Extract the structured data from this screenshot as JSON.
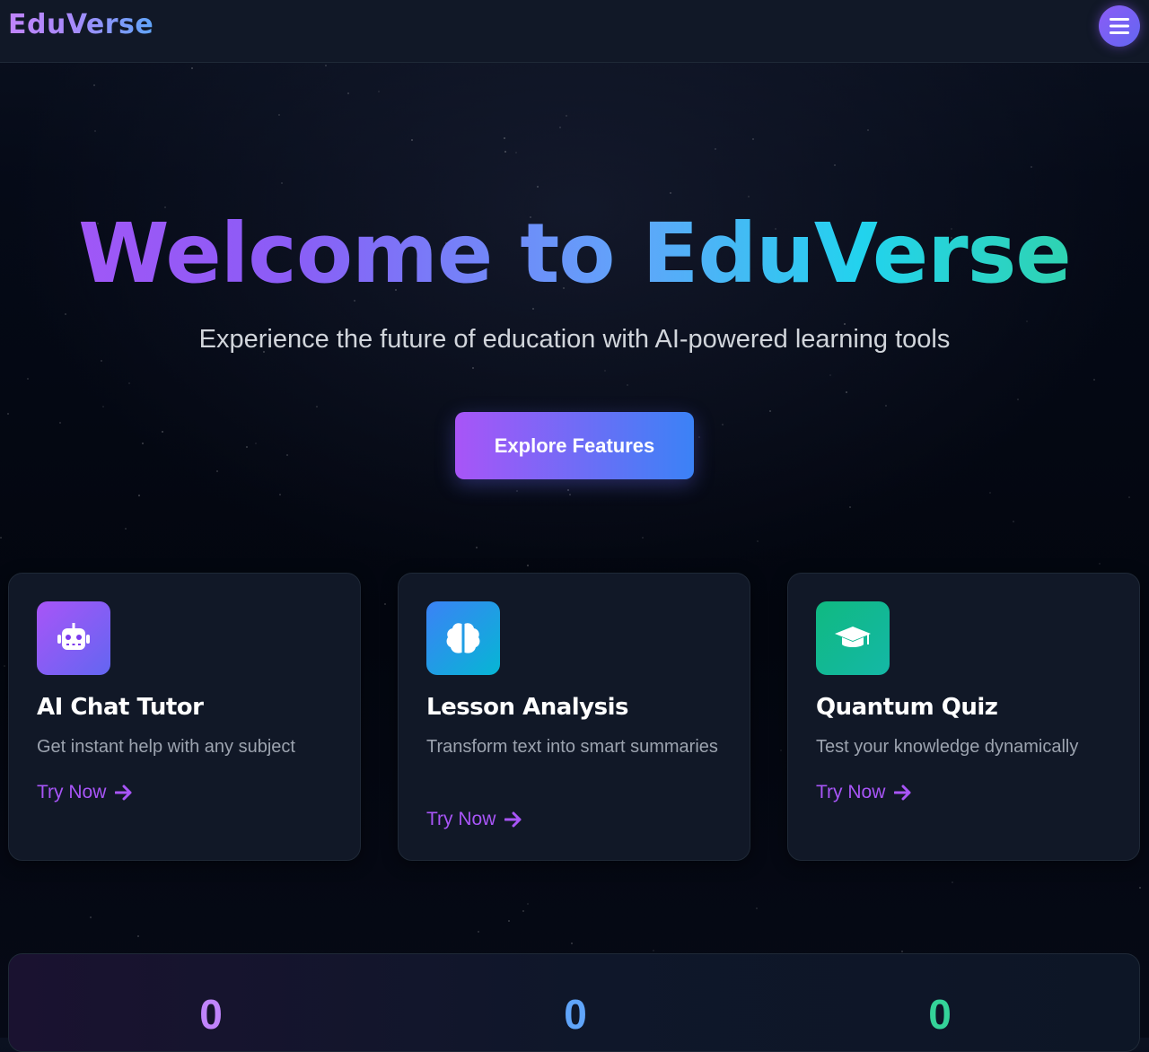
{
  "header": {
    "logo_text": "EduVerse",
    "menu_icon": "hamburger-menu-icon"
  },
  "hero": {
    "title": "Welcome to EduVerse",
    "subtitle": "Experience the future of education with AI-powered learning tools",
    "cta_label": "Explore Features"
  },
  "features": [
    {
      "icon": "robot-icon",
      "icon_color_from": "#a855f7",
      "icon_color_to": "#6366f1",
      "title": "AI Chat Tutor",
      "description": "Get instant help with any subject",
      "link_label": "Try Now"
    },
    {
      "icon": "brain-icon",
      "icon_color_from": "#3b82f6",
      "icon_color_to": "#06b6d4",
      "title": "Lesson Analysis",
      "description": "Transform text into smart summaries",
      "link_label": "Try Now"
    },
    {
      "icon": "graduation-cap-icon",
      "icon_color_from": "#10b981",
      "icon_color_to": "#14b8a6",
      "title": "Quantum Quiz",
      "description": "Test your knowledge dynamically",
      "link_label": "Try Now"
    }
  ],
  "stats": [
    {
      "value": "0",
      "color": "#c084fc"
    },
    {
      "value": "0",
      "color": "#60a5fa"
    },
    {
      "value": "0",
      "color": "#34d399"
    }
  ],
  "colors": {
    "accent_purple": "#a855f7",
    "accent_blue": "#3b82f6",
    "accent_green": "#10b981",
    "background": "#030712",
    "card_background": "#111827"
  }
}
